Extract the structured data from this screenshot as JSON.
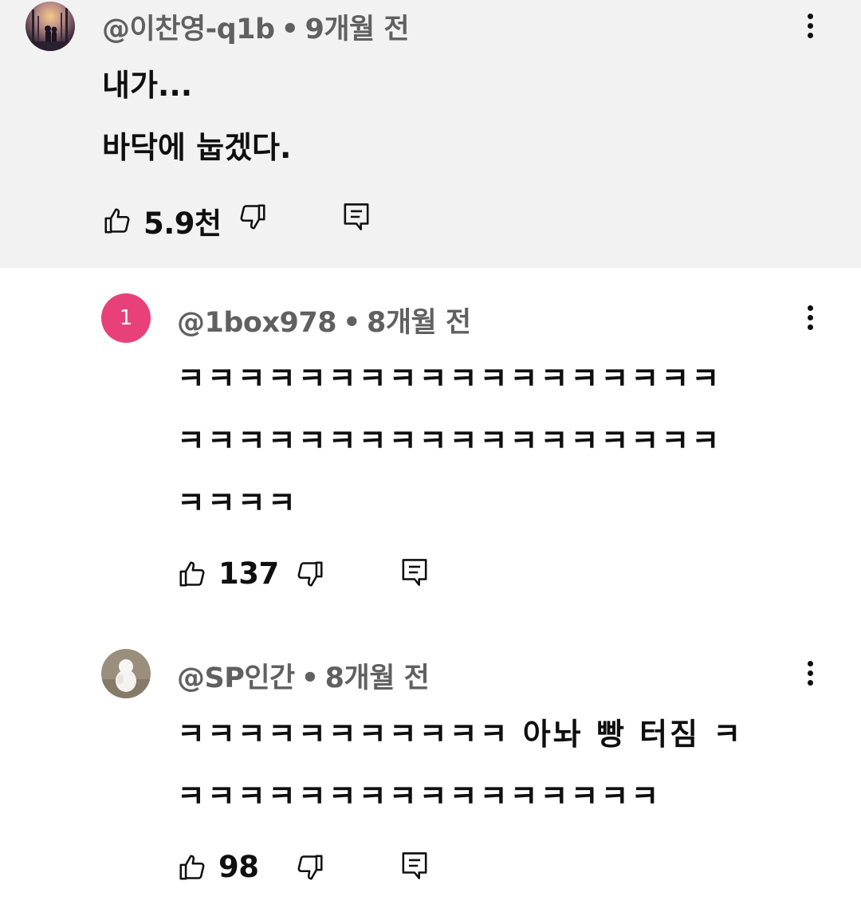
{
  "comments": [
    {
      "author": "@이찬영-q1b",
      "time": "9개월 전",
      "text_lines": [
        "내가...",
        "바닥에 눕겠다."
      ],
      "likes": "5.9천",
      "avatar": "photo-avatar"
    },
    {
      "author": "@1box978",
      "time": "8개월 전",
      "text_lines": [
        "ㅋㅋㅋㅋㅋㅋㅋㅋㅋㅋㅋㅋㅋㅋㅋㅋㅋㅋ",
        "ㅋㅋㅋㅋㅋㅋㅋㅋㅋㅋㅋㅋㅋㅋㅋㅋㅋㅋ",
        "ㅋㅋㅋㅋ"
      ],
      "likes": "137",
      "avatar_letter": "1",
      "avatar_color": "#e8417a"
    },
    {
      "author": "@SP인간",
      "time": "8개월 전",
      "text_lines": [
        "ㅋㅋㅋㅋㅋㅋㅋㅋㅋㅋㅋ 아놔 빵 터짐 ㅋ",
        "ㅋㅋㅋㅋㅋㅋㅋㅋㅋㅋㅋㅋㅋㅋㅋㅋ"
      ],
      "likes": "98",
      "avatar": "photo-avatar"
    }
  ],
  "meta_separator": "•",
  "icons": {
    "like": "thumbs-up-icon",
    "dislike": "thumbs-down-icon",
    "reply": "reply-icon",
    "more": "more-vertical-icon"
  },
  "colors": {
    "highlight_bg": "#f2f2f2",
    "meta_text": "#606060",
    "primary_text": "#0f0f0f"
  }
}
